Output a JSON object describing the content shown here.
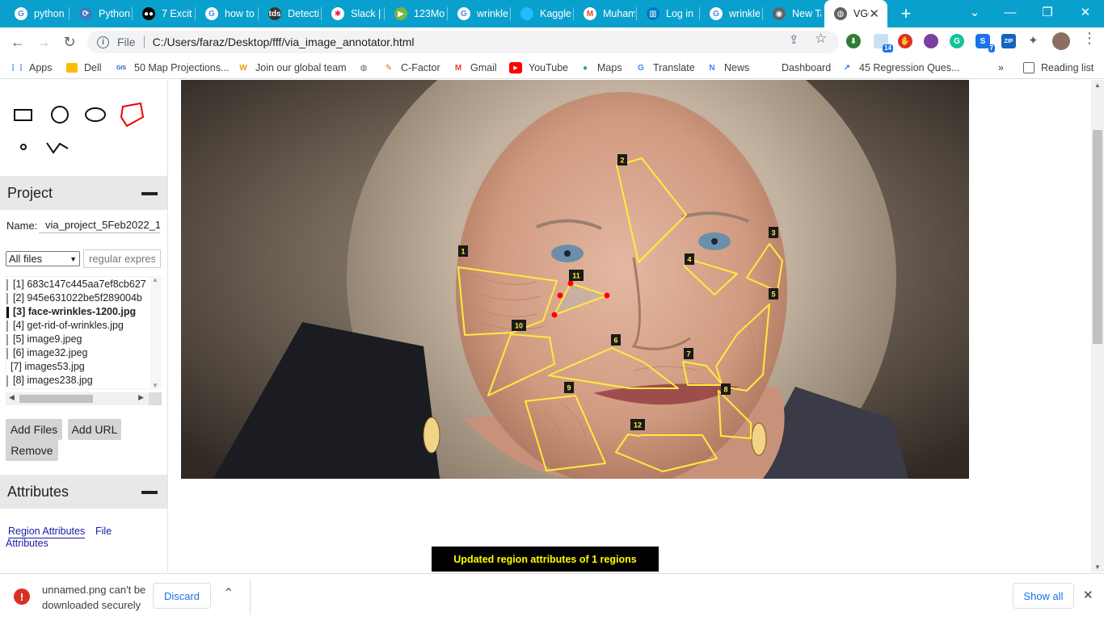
{
  "browser": {
    "tabs": [
      {
        "title": "python",
        "icon": "google-icon",
        "color": "#ffffff"
      },
      {
        "title": "Python",
        "icon": "python-icon",
        "color": "#3b7bbf"
      },
      {
        "title": "7 Excit",
        "icon": "medium-icon",
        "color": "#000000"
      },
      {
        "title": "how to",
        "icon": "google-icon",
        "color": "#ffffff"
      },
      {
        "title": "Detecti",
        "icon": "tds-icon",
        "color": "#333333"
      },
      {
        "title": "Slack |",
        "icon": "slack-icon",
        "color": "#ffffff"
      },
      {
        "title": "123Mo",
        "icon": "play-icon",
        "color": "#7cb342"
      },
      {
        "title": "wrinkle",
        "icon": "google-icon",
        "color": "#ffffff"
      },
      {
        "title": "Kaggle",
        "icon": "kaggle-icon",
        "color": "#20beff"
      },
      {
        "title": "Muham",
        "icon": "gmail-icon",
        "color": "#ffffff"
      },
      {
        "title": "Log in",
        "icon": "trello-icon",
        "color": "#0079bf"
      },
      {
        "title": "wrinkle",
        "icon": "google-icon",
        "color": "#ffffff"
      },
      {
        "title": "New Ta",
        "icon": "chrome-icon",
        "color": "#5f6368"
      },
      {
        "title": "VGG",
        "icon": "globe-icon",
        "color": "#5f6368",
        "active": true
      }
    ],
    "new_tab_glyph": "+",
    "window_controls": {
      "menu": "⌄",
      "minimize": "—",
      "restore": "❐",
      "close": "✕"
    },
    "address": {
      "scheme": "File",
      "url": "C:/Users/faraz/Desktop/fff/via_image_annotator.html"
    },
    "extensions": [
      {
        "name": "share-icon",
        "badge": ""
      },
      {
        "name": "star-icon",
        "badge": ""
      },
      {
        "name": "idm-icon",
        "badge": ""
      },
      {
        "name": "calendar-ext-icon",
        "badge": "14"
      },
      {
        "name": "adblock-icon",
        "badge": ""
      },
      {
        "name": "tor-icon",
        "badge": ""
      },
      {
        "name": "grammarly-icon",
        "badge": ""
      },
      {
        "name": "skype-icon",
        "badge": "7"
      },
      {
        "name": "zip-icon",
        "badge": "ZIP"
      },
      {
        "name": "puzzle-icon",
        "badge": ""
      },
      {
        "name": "profile-avatar",
        "badge": ""
      },
      {
        "name": "kebab-menu-icon",
        "badge": ""
      }
    ],
    "bookmarks": [
      {
        "label": "Apps",
        "icon": "apps-grid-icon",
        "color": "#4285f4"
      },
      {
        "label": "Dell",
        "icon": "folder-icon",
        "color": "#fbbc04"
      },
      {
        "label": "50 Map Projections...",
        "icon": "gis-icon",
        "color": "#1a5ea8"
      },
      {
        "label": "Join our global team",
        "icon": "w-icon",
        "color": "#f29900"
      },
      {
        "label": "",
        "icon": "globe-icon",
        "color": "#5f6368"
      },
      {
        "label": "C-Factor",
        "icon": "c-factor-icon",
        "color": "#e8710a"
      },
      {
        "label": "Gmail",
        "icon": "gmail-icon",
        "color": "#ea4335"
      },
      {
        "label": "YouTube",
        "icon": "youtube-icon",
        "color": "#ff0000"
      },
      {
        "label": "Maps",
        "icon": "maps-pin-icon",
        "color": "#34a853"
      },
      {
        "label": "Translate",
        "icon": "translate-icon",
        "color": "#4285f4"
      },
      {
        "label": "News",
        "icon": "news-icon",
        "color": "#4285f4"
      },
      {
        "label": "Dashboard",
        "icon": "",
        "color": ""
      },
      {
        "label": "45 Regression Ques...",
        "icon": "chart-line-icon",
        "color": "#1a73e8"
      }
    ],
    "bookmarks_overflow": "»",
    "reading_list": "Reading list"
  },
  "via": {
    "project": {
      "header": "Project",
      "name_label": "Name:",
      "name_value": "via_project_5Feb2022_1",
      "filter_selected": "All files",
      "filter_options": [
        "All files"
      ],
      "regex_placeholder": "regular expression",
      "files": [
        {
          "label": "[1] 683c147c445aa7ef8cb627",
          "current": false,
          "marked": true
        },
        {
          "label": "[2] 945e631022be5f289004b",
          "current": false,
          "marked": true
        },
        {
          "label": "[3] face-wrinkles-1200.jpg",
          "current": true,
          "marked": true
        },
        {
          "label": "[4] get-rid-of-wrinkles.jpg",
          "current": false,
          "marked": true
        },
        {
          "label": "[5] image9.jpeg",
          "current": false,
          "marked": true
        },
        {
          "label": "[6] image32.jpeg",
          "current": false,
          "marked": true
        },
        {
          "label": "[7] images53.jpg",
          "current": false,
          "marked": false
        },
        {
          "label": "[8] images238.jpg",
          "current": false,
          "marked": true
        }
      ],
      "buttons": {
        "add_files": "Add Files",
        "add_url": "Add URL",
        "remove": "Remove"
      }
    },
    "attributes": {
      "header": "Attributes",
      "tab_region": "Region Attributes",
      "tab_file_1": "File",
      "tab_file_2": "Attributes"
    },
    "shape_tools": [
      "rectangle",
      "circle",
      "ellipse",
      "polygon",
      "point",
      "polyline"
    ],
    "active_tool": "polygon",
    "regions": [
      {
        "id": "1"
      },
      {
        "id": "2"
      },
      {
        "id": "3"
      },
      {
        "id": "4"
      },
      {
        "id": "5"
      },
      {
        "id": "6"
      },
      {
        "id": "7"
      },
      {
        "id": "8"
      },
      {
        "id": "9"
      },
      {
        "id": "10"
      },
      {
        "id": "11"
      },
      {
        "id": "12"
      }
    ],
    "selected_region": "11",
    "region_color": "#ffeb3b",
    "message": "Updated region attributes of 1 regions"
  },
  "download": {
    "warning": "unnamed.png can't be downloaded securely",
    "discard": "Discard",
    "chevron": "⌃",
    "show_all": "Show all",
    "close": "✕"
  }
}
